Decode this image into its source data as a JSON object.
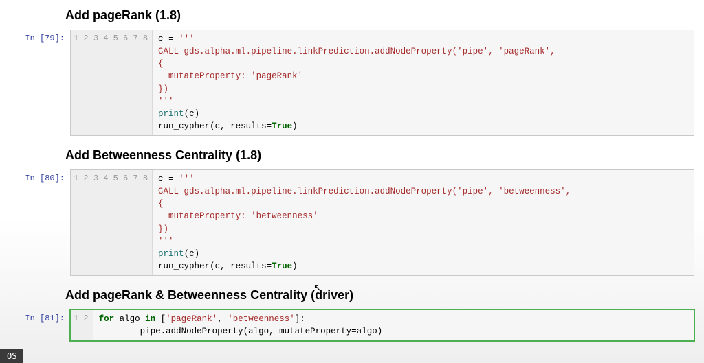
{
  "headings": {
    "h1": "Add pageRank (1.8)",
    "h2": "Add Betweenness Centrality (1.8)",
    "h3": "Add pageRank & Betweenness Centrality (driver)"
  },
  "cells": [
    {
      "prompt": "In [79]:",
      "gutter": [
        "1",
        "2",
        "3",
        "4",
        "5",
        "6",
        "7",
        "8"
      ],
      "tokens": {
        "l1a": "c ",
        "l1b": "= ",
        "l1c": "'''",
        "l2": "CALL gds.alpha.ml.pipeline.linkPrediction.addNodeProperty('pipe', 'pageRank',",
        "l3": "{",
        "l4": "  mutateProperty: 'pageRank'",
        "l5": "})",
        "l6": "'''",
        "l7a": "print",
        "l7b": "(c)",
        "l8a": "run_cypher",
        "l8b": "(c, results",
        "l8c": "=",
        "l8d": "True",
        "l8e": ")"
      }
    },
    {
      "prompt": "In [80]:",
      "gutter": [
        "1",
        "2",
        "3",
        "4",
        "5",
        "6",
        "7",
        "8"
      ],
      "tokens": {
        "l1a": "c ",
        "l1b": "= ",
        "l1c": "'''",
        "l2": "CALL gds.alpha.ml.pipeline.linkPrediction.addNodeProperty('pipe', 'betweenness',",
        "l3": "{",
        "l4": "  mutateProperty: 'betweenness'",
        "l5": "})",
        "l6": "'''",
        "l7a": "print",
        "l7b": "(c)",
        "l8a": "run_cypher",
        "l8b": "(c, results",
        "l8c": "=",
        "l8d": "True",
        "l8e": ")"
      }
    },
    {
      "prompt": "In [81]:",
      "gutter": [
        "1",
        "2"
      ],
      "tokens": {
        "l1a": "for",
        "l1b": " algo ",
        "l1c": "in",
        "l1d": " [",
        "l1e": "'pageRank'",
        "l1f": ", ",
        "l1g": "'betweenness'",
        "l1h": "]:",
        "l2a": "        pipe.addNodeProperty(algo, mutateProperty",
        "l2b": "=",
        "l2c": "algo)"
      }
    }
  ],
  "os_badge": "OS"
}
